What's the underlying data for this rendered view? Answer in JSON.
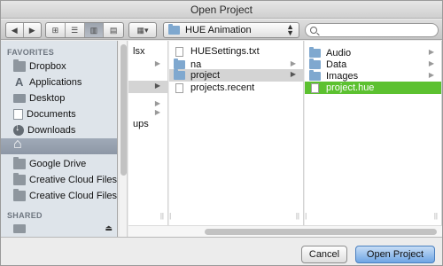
{
  "window": {
    "title": "Open Project"
  },
  "toolbar": {
    "back_icon": "◀",
    "forward_icon": "▶",
    "view_icons": [
      "⊞",
      "☰",
      "▥",
      "▤"
    ],
    "arrange_icon": "▦▾",
    "location": "HUE Animation",
    "location_icon": "updown-arrows",
    "search_value": "",
    "search_placeholder": ""
  },
  "sidebar": {
    "favorites_heading": "FAVORITES",
    "shared_heading": "SHARED",
    "items": [
      {
        "label": "Dropbox",
        "icon": "folder-icon"
      },
      {
        "label": "Applications",
        "icon": "applications-icon"
      },
      {
        "label": "Desktop",
        "icon": "desktop-icon"
      },
      {
        "label": "Documents",
        "icon": "documents-icon"
      },
      {
        "label": "Downloads",
        "icon": "downloads-icon"
      },
      {
        "label": "",
        "icon": "home-icon"
      },
      {
        "label": "Google Drive",
        "icon": "folder-icon"
      },
      {
        "label": "Creative Cloud Files",
        "icon": "folder-icon"
      },
      {
        "label": "Creative Cloud Files",
        "icon": "folder-icon"
      }
    ],
    "shared_items": [
      {
        "label": "",
        "icon": "monitor-icon"
      }
    ]
  },
  "columns": {
    "col0": [
      {
        "label": "lsx"
      },
      {
        "label": ""
      },
      {
        "label": ""
      },
      {
        "label": ""
      },
      {
        "label": ""
      },
      {
        "label": "ups"
      }
    ],
    "col1": [
      {
        "label": "HUESettings.txt",
        "type": "file"
      },
      {
        "label": "na",
        "type": "folder"
      },
      {
        "label": "project",
        "type": "folder"
      },
      {
        "label": "projects.recent",
        "type": "file"
      }
    ],
    "col2": [
      {
        "label": "Audio",
        "type": "folder"
      },
      {
        "label": "Data",
        "type": "folder"
      },
      {
        "label": "Images",
        "type": "folder"
      },
      {
        "label": "project.hue",
        "type": "file"
      }
    ]
  },
  "footer": {
    "cancel_label": "Cancel",
    "open_label": "Open Project"
  },
  "colors": {
    "selection_green": "#5cc130",
    "sidebar_bg": "#dee4ea",
    "primary_button": "#6ea5e4"
  }
}
